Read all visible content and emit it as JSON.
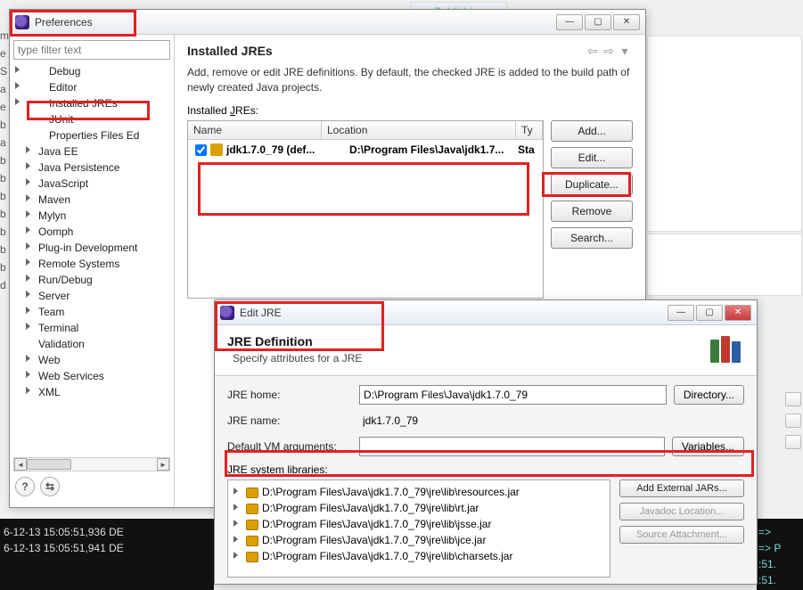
{
  "bg": {
    "tab_text": "Publishing",
    "edge_letters": [
      "m",
      "e",
      "",
      "",
      "S",
      "a",
      "e",
      "b",
      "a",
      "b",
      "b",
      "b",
      "",
      "b",
      "b",
      "b",
      "b",
      "d"
    ],
    "console_lines": [
      "6-12-13 15:05:51,936 DE",
      "6-12-13 15:05:51,941 DE"
    ],
    "console_r_lines": [
      "=>",
      "=> P",
      ":51.",
      ":51."
    ]
  },
  "pref": {
    "title": "Preferences",
    "filter_placeholder": "type filter text",
    "tree": [
      {
        "label": "Debug",
        "level": 2,
        "arrow": true
      },
      {
        "label": "Editor",
        "level": 2,
        "arrow": true
      },
      {
        "label": "Installed JREs",
        "level": 2,
        "arrow": true
      },
      {
        "label": "JUnit",
        "level": 2,
        "arrow": false
      },
      {
        "label": "Properties Files Ed",
        "level": 2,
        "arrow": false
      },
      {
        "label": "Java EE",
        "level": 1,
        "arrow": true
      },
      {
        "label": "Java Persistence",
        "level": 1,
        "arrow": true
      },
      {
        "label": "JavaScript",
        "level": 1,
        "arrow": true
      },
      {
        "label": "Maven",
        "level": 1,
        "arrow": true
      },
      {
        "label": "Mylyn",
        "level": 1,
        "arrow": true
      },
      {
        "label": "Oomph",
        "level": 1,
        "arrow": true
      },
      {
        "label": "Plug-in Development",
        "level": 1,
        "arrow": true
      },
      {
        "label": "Remote Systems",
        "level": 1,
        "arrow": true
      },
      {
        "label": "Run/Debug",
        "level": 1,
        "arrow": true
      },
      {
        "label": "Server",
        "level": 1,
        "arrow": true
      },
      {
        "label": "Team",
        "level": 1,
        "arrow": true
      },
      {
        "label": "Terminal",
        "level": 1,
        "arrow": true
      },
      {
        "label": "Validation",
        "level": 1,
        "arrow": false
      },
      {
        "label": "Web",
        "level": 1,
        "arrow": true
      },
      {
        "label": "Web Services",
        "level": 1,
        "arrow": true
      },
      {
        "label": "XML",
        "level": 1,
        "arrow": true
      }
    ],
    "page_title": "Installed JREs",
    "desc": "Add, remove or edit JRE definitions. By default, the checked JRE is added to the build path of newly created Java projects.",
    "list_label_pre": "Installed ",
    "list_label_u": "J",
    "list_label_post": "REs:",
    "columns": {
      "name": "Name",
      "location": "Location",
      "type": "Ty"
    },
    "row": {
      "name": "jdk1.7.0_79 (def...",
      "location": "D:\\Program Files\\Java\\jdk1.7...",
      "type": "Sta"
    },
    "buttons": {
      "add": "Add...",
      "edit": "Edit...",
      "duplicate": "Duplicate...",
      "remove": "Remove",
      "search": "Search..."
    },
    "help": "?",
    "import": "⇆"
  },
  "edit": {
    "title": "Edit JRE",
    "header_title": "JRE Definition",
    "header_sub": "Specify attributes for a JRE",
    "labels": {
      "home": "JRE home:",
      "name": "JRE name:",
      "vmargs": "Default VM arguments:",
      "syslib": "JRE system libraries:"
    },
    "values": {
      "home": "D:\\Program Files\\Java\\jdk1.7.0_79",
      "name": "jdk1.7.0_79",
      "vmargs": ""
    },
    "buttons": {
      "directory": "Directory...",
      "variables": "Variables...",
      "add_ext": "Add External JARs...",
      "javadoc": "Javadoc Location...",
      "source": "Source Attachment..."
    },
    "libs": [
      "D:\\Program Files\\Java\\jdk1.7.0_79\\jre\\lib\\resources.jar",
      "D:\\Program Files\\Java\\jdk1.7.0_79\\jre\\lib\\rt.jar",
      "D:\\Program Files\\Java\\jdk1.7.0_79\\jre\\lib\\jsse.jar",
      "D:\\Program Files\\Java\\jdk1.7.0_79\\jre\\lib\\jce.jar",
      "D:\\Program Files\\Java\\jdk1.7.0_79\\jre\\lib\\charsets.jar"
    ]
  }
}
